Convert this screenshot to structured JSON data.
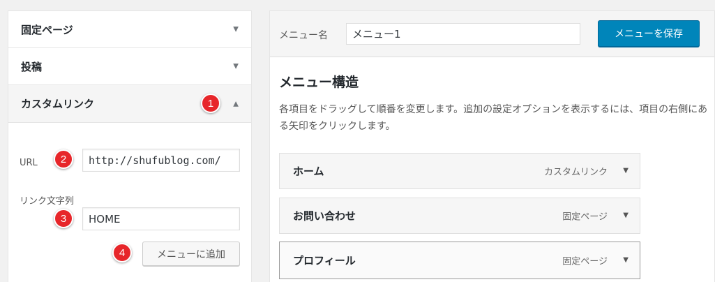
{
  "left": {
    "sections": [
      {
        "label": "固定ページ"
      },
      {
        "label": "投稿"
      },
      {
        "label": "カスタムリンク"
      }
    ],
    "url_label": "URL",
    "url_value": "http://shufublog.com/",
    "link_text_label": "リンク文字列",
    "link_text_value": "HOME",
    "add_button": "メニューに追加"
  },
  "badges": [
    "1",
    "2",
    "3",
    "4"
  ],
  "right": {
    "menu_name_label": "メニュー名",
    "menu_name_value": "メニュー1",
    "save_button": "メニューを保存",
    "structure_title": "メニュー構造",
    "structure_desc": "各項目をドラッグして順番を変更します。追加の設定オプションを表示するには、項目の右側にある矢印をクリックします。",
    "items": [
      {
        "title": "ホーム",
        "type": "カスタムリンク"
      },
      {
        "title": "お問い合わせ",
        "type": "固定ページ"
      },
      {
        "title": "プロフィール",
        "type": "固定ページ"
      }
    ]
  },
  "colors": {
    "primary": "#0085ba",
    "badge": "#e7262a"
  },
  "icons": {
    "collapsed": "triangle-down",
    "expanded": "triangle-up"
  }
}
